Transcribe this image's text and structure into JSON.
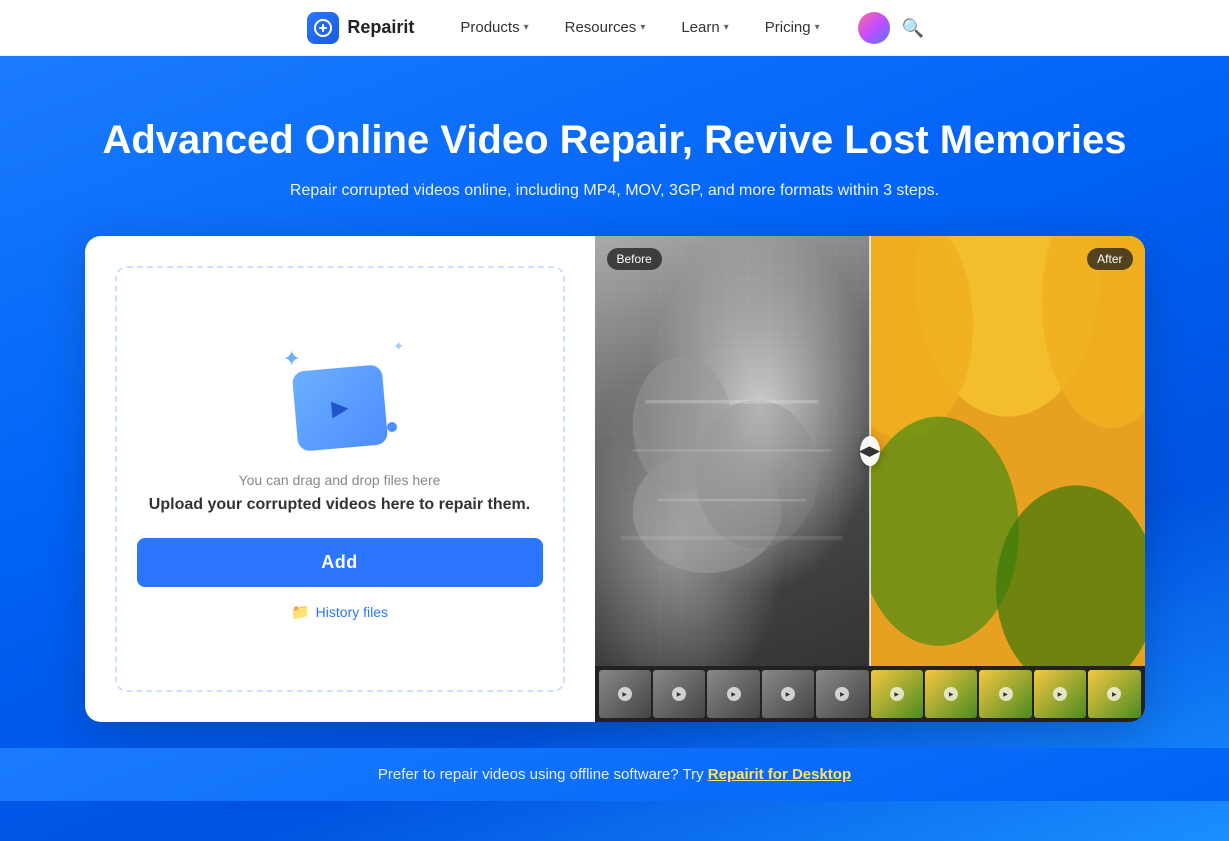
{
  "navbar": {
    "logo_text": "Repairit",
    "products_label": "Products",
    "resources_label": "Resources",
    "learn_label": "Learn",
    "pricing_label": "Pricing"
  },
  "hero": {
    "title": "Advanced Online Video Repair, Revive Lost Memories",
    "subtitle": "Repair corrupted videos online, including MP4, MOV, 3GP, and more formats within 3 steps."
  },
  "upload_panel": {
    "drag_text": "You can drag and drop files here",
    "upload_label": "Upload your corrupted videos here to repair them.",
    "add_button": "Add",
    "history_label": "History files"
  },
  "preview": {
    "before_badge": "Before",
    "after_badge": "After",
    "divider_arrows": "◀▶"
  },
  "footer_bar": {
    "text": "Prefer to repair videos using offline software? Try ",
    "link_text": "Repairit for Desktop"
  }
}
